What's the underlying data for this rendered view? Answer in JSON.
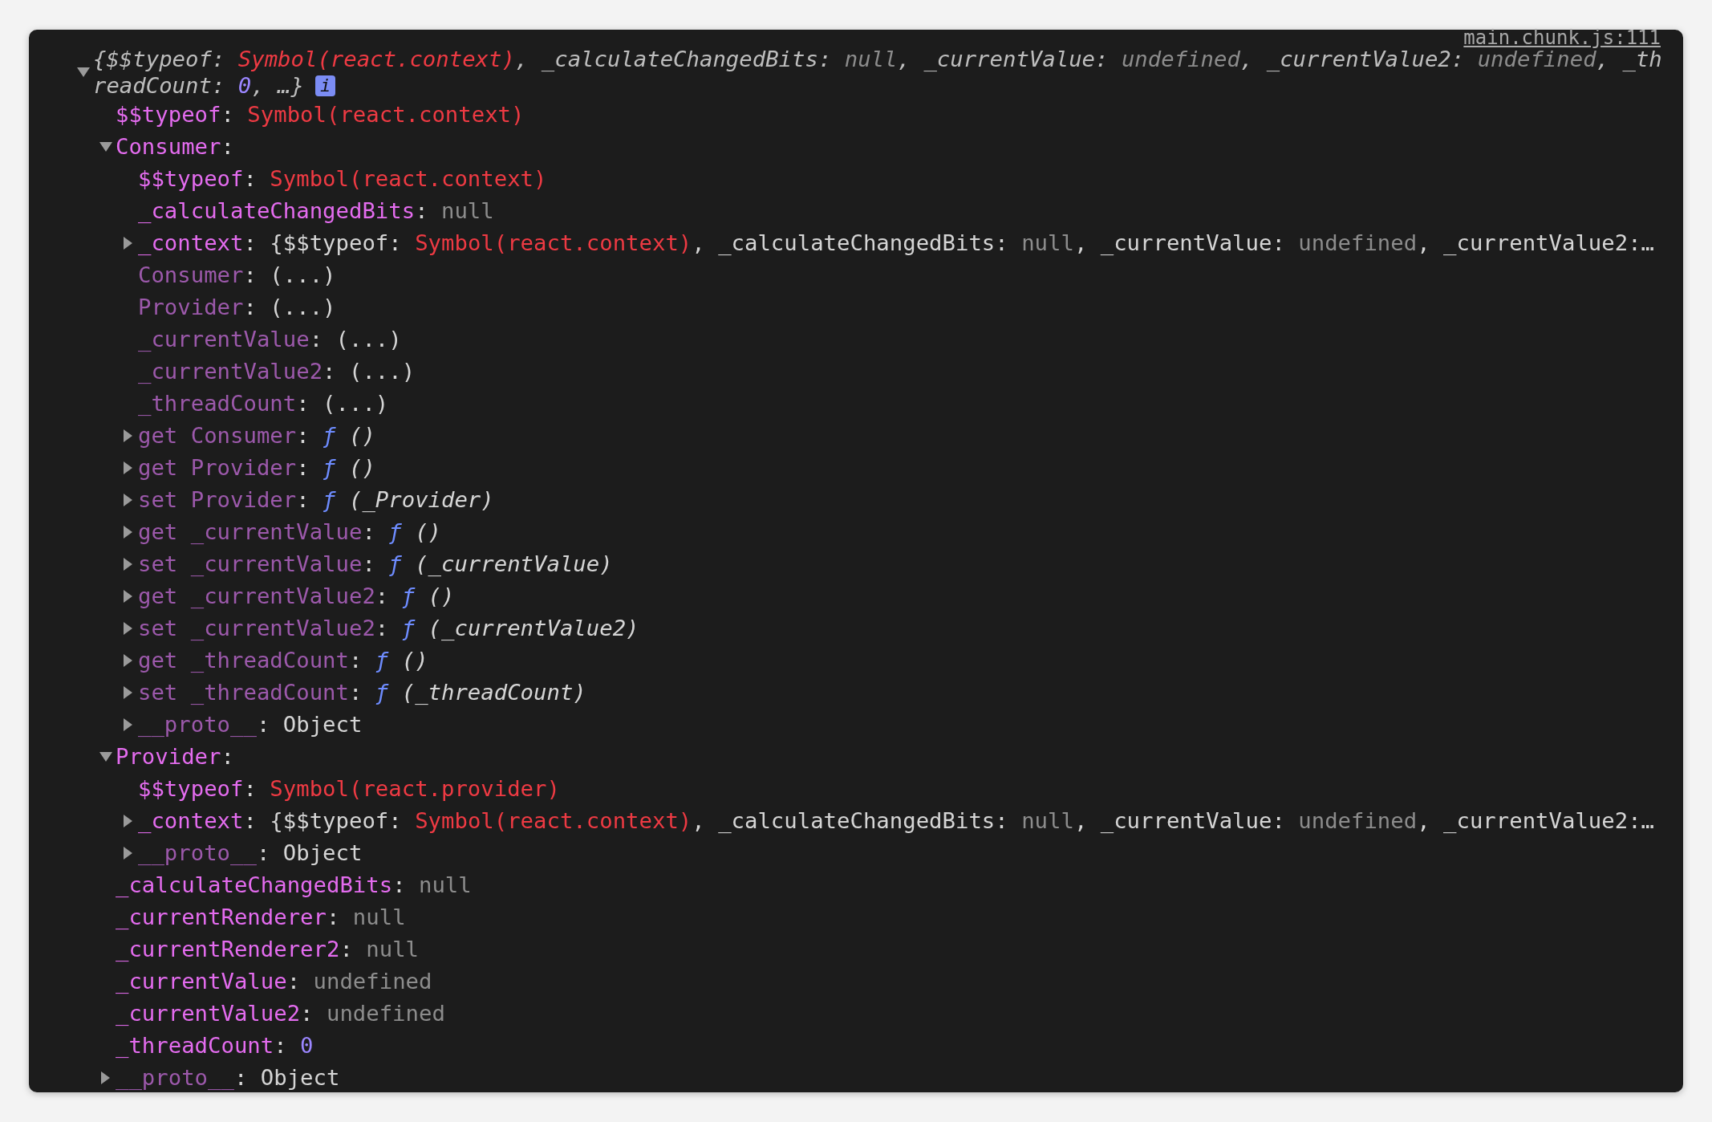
{
  "source_link": "main.chunk.js:111",
  "root": {
    "kind": "summary",
    "expanded": true,
    "badge": "i",
    "segments": [
      {
        "kind": "plain",
        "text": "{$$typeof: "
      },
      {
        "kind": "symbol",
        "text": "Symbol(react.context)"
      },
      {
        "kind": "plain",
        "text": ", _calculateChangedBits: "
      },
      {
        "kind": "muted",
        "text": "null"
      },
      {
        "kind": "plain",
        "text": ", _currentValue: "
      },
      {
        "kind": "muted",
        "text": "undefined"
      },
      {
        "kind": "plain",
        "text": ", _currentValue2: "
      },
      {
        "kind": "muted",
        "text": "undefined"
      },
      {
        "kind": "plain",
        "text": ", _threadCount: "
      },
      {
        "kind": "number",
        "text": "0"
      },
      {
        "kind": "plain",
        "text": ", …}"
      }
    ],
    "children": [
      {
        "segments": [
          {
            "kind": "key",
            "text": "$$typeof"
          },
          {
            "kind": "plain",
            "text": ": "
          },
          {
            "kind": "symbol",
            "text": "Symbol(react.context)"
          }
        ]
      },
      {
        "expanded": true,
        "segments": [
          {
            "kind": "key",
            "text": "Consumer"
          },
          {
            "kind": "plain",
            "text": ":"
          }
        ],
        "children": [
          {
            "segments": [
              {
                "kind": "key",
                "text": "$$typeof"
              },
              {
                "kind": "plain",
                "text": ": "
              },
              {
                "kind": "symbol",
                "text": "Symbol(react.context)"
              }
            ]
          },
          {
            "segments": [
              {
                "kind": "key",
                "text": "_calculateChangedBits"
              },
              {
                "kind": "plain",
                "text": ": "
              },
              {
                "kind": "muted",
                "text": "null"
              }
            ]
          },
          {
            "expanded": false,
            "segments": [
              {
                "kind": "key",
                "text": "_context"
              },
              {
                "kind": "plain",
                "text": ": {$$typeof: "
              },
              {
                "kind": "symbol",
                "text": "Symbol(react.context)"
              },
              {
                "kind": "plain",
                "text": ", _calculateChangedBits: "
              },
              {
                "kind": "muted",
                "text": "null"
              },
              {
                "kind": "plain",
                "text": ", _currentValue: "
              },
              {
                "kind": "muted",
                "text": "undefined"
              },
              {
                "kind": "plain",
                "text": ", _currentValue2:…"
              }
            ]
          },
          {
            "segments": [
              {
                "kind": "key_dim",
                "text": "Consumer"
              },
              {
                "kind": "plain",
                "text": ": (...)"
              }
            ]
          },
          {
            "segments": [
              {
                "kind": "key_dim",
                "text": "Provider"
              },
              {
                "kind": "plain",
                "text": ": (...)"
              }
            ]
          },
          {
            "segments": [
              {
                "kind": "key_dim",
                "text": "_currentValue"
              },
              {
                "kind": "plain",
                "text": ": (...)"
              }
            ]
          },
          {
            "segments": [
              {
                "kind": "key_dim",
                "text": "_currentValue2"
              },
              {
                "kind": "plain",
                "text": ": (...)"
              }
            ]
          },
          {
            "segments": [
              {
                "kind": "key_dim",
                "text": "_threadCount"
              },
              {
                "kind": "plain",
                "text": ": (...)"
              }
            ]
          },
          {
            "expanded": false,
            "segments": [
              {
                "kind": "key_dim",
                "text": "get Consumer"
              },
              {
                "kind": "plain",
                "text": ": "
              },
              {
                "kind": "func",
                "text": "ƒ"
              },
              {
                "kind": "signature",
                "text": " ()"
              }
            ]
          },
          {
            "expanded": false,
            "segments": [
              {
                "kind": "key_dim",
                "text": "get Provider"
              },
              {
                "kind": "plain",
                "text": ": "
              },
              {
                "kind": "func",
                "text": "ƒ"
              },
              {
                "kind": "signature",
                "text": " ()"
              }
            ]
          },
          {
            "expanded": false,
            "segments": [
              {
                "kind": "key_dim",
                "text": "set Provider"
              },
              {
                "kind": "plain",
                "text": ": "
              },
              {
                "kind": "func",
                "text": "ƒ"
              },
              {
                "kind": "signature",
                "text": " (_Provider)"
              }
            ]
          },
          {
            "expanded": false,
            "segments": [
              {
                "kind": "key_dim",
                "text": "get _currentValue"
              },
              {
                "kind": "plain",
                "text": ": "
              },
              {
                "kind": "func",
                "text": "ƒ"
              },
              {
                "kind": "signature",
                "text": " ()"
              }
            ]
          },
          {
            "expanded": false,
            "segments": [
              {
                "kind": "key_dim",
                "text": "set _currentValue"
              },
              {
                "kind": "plain",
                "text": ": "
              },
              {
                "kind": "func",
                "text": "ƒ"
              },
              {
                "kind": "signature",
                "text": " (_currentValue)"
              }
            ]
          },
          {
            "expanded": false,
            "segments": [
              {
                "kind": "key_dim",
                "text": "get _currentValue2"
              },
              {
                "kind": "plain",
                "text": ": "
              },
              {
                "kind": "func",
                "text": "ƒ"
              },
              {
                "kind": "signature",
                "text": " ()"
              }
            ]
          },
          {
            "expanded": false,
            "segments": [
              {
                "kind": "key_dim",
                "text": "set _currentValue2"
              },
              {
                "kind": "plain",
                "text": ": "
              },
              {
                "kind": "func",
                "text": "ƒ"
              },
              {
                "kind": "signature",
                "text": " (_currentValue2)"
              }
            ]
          },
          {
            "expanded": false,
            "segments": [
              {
                "kind": "key_dim",
                "text": "get _threadCount"
              },
              {
                "kind": "plain",
                "text": ": "
              },
              {
                "kind": "func",
                "text": "ƒ"
              },
              {
                "kind": "signature",
                "text": " ()"
              }
            ]
          },
          {
            "expanded": false,
            "segments": [
              {
                "kind": "key_dim",
                "text": "set _threadCount"
              },
              {
                "kind": "plain",
                "text": ": "
              },
              {
                "kind": "func",
                "text": "ƒ"
              },
              {
                "kind": "signature",
                "text": " (_threadCount)"
              }
            ]
          },
          {
            "expanded": false,
            "segments": [
              {
                "kind": "key_dim",
                "text": "__proto__"
              },
              {
                "kind": "plain",
                "text": ": Object"
              }
            ]
          }
        ]
      },
      {
        "expanded": true,
        "segments": [
          {
            "kind": "key",
            "text": "Provider"
          },
          {
            "kind": "plain",
            "text": ":"
          }
        ],
        "children": [
          {
            "segments": [
              {
                "kind": "key",
                "text": "$$typeof"
              },
              {
                "kind": "plain",
                "text": ": "
              },
              {
                "kind": "symbol",
                "text": "Symbol(react.provider)"
              }
            ]
          },
          {
            "expanded": false,
            "segments": [
              {
                "kind": "key",
                "text": "_context"
              },
              {
                "kind": "plain",
                "text": ": {$$typeof: "
              },
              {
                "kind": "symbol",
                "text": "Symbol(react.context)"
              },
              {
                "kind": "plain",
                "text": ", _calculateChangedBits: "
              },
              {
                "kind": "muted",
                "text": "null"
              },
              {
                "kind": "plain",
                "text": ", _currentValue: "
              },
              {
                "kind": "muted",
                "text": "undefined"
              },
              {
                "kind": "plain",
                "text": ", _currentValue2:…"
              }
            ]
          },
          {
            "expanded": false,
            "segments": [
              {
                "kind": "key_dim",
                "text": "__proto__"
              },
              {
                "kind": "plain",
                "text": ": Object"
              }
            ]
          }
        ]
      },
      {
        "segments": [
          {
            "kind": "key",
            "text": "_calculateChangedBits"
          },
          {
            "kind": "plain",
            "text": ": "
          },
          {
            "kind": "muted",
            "text": "null"
          }
        ]
      },
      {
        "segments": [
          {
            "kind": "key",
            "text": "_currentRenderer"
          },
          {
            "kind": "plain",
            "text": ": "
          },
          {
            "kind": "muted",
            "text": "null"
          }
        ]
      },
      {
        "segments": [
          {
            "kind": "key",
            "text": "_currentRenderer2"
          },
          {
            "kind": "plain",
            "text": ": "
          },
          {
            "kind": "muted",
            "text": "null"
          }
        ]
      },
      {
        "segments": [
          {
            "kind": "key",
            "text": "_currentValue"
          },
          {
            "kind": "plain",
            "text": ": "
          },
          {
            "kind": "muted",
            "text": "undefined"
          }
        ]
      },
      {
        "segments": [
          {
            "kind": "key",
            "text": "_currentValue2"
          },
          {
            "kind": "plain",
            "text": ": "
          },
          {
            "kind": "muted",
            "text": "undefined"
          }
        ]
      },
      {
        "segments": [
          {
            "kind": "key",
            "text": "_threadCount"
          },
          {
            "kind": "plain",
            "text": ": "
          },
          {
            "kind": "number",
            "text": "0"
          }
        ]
      },
      {
        "expanded": false,
        "segments": [
          {
            "kind": "key_dim",
            "text": "__proto__"
          },
          {
            "kind": "plain",
            "text": ": Object"
          }
        ]
      }
    ]
  }
}
